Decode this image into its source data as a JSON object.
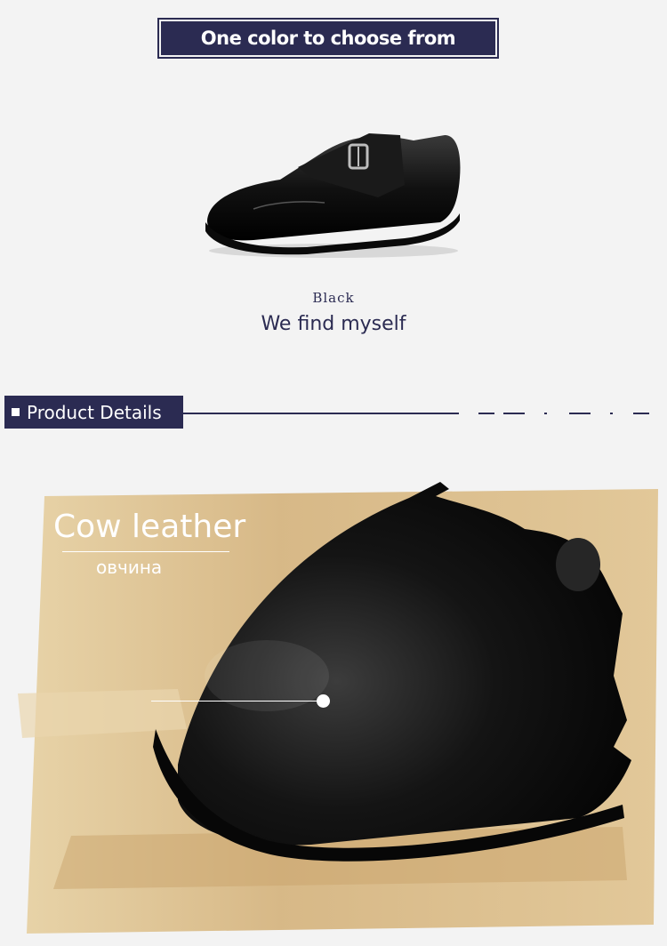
{
  "banner": {
    "text": "One color to choose from"
  },
  "colors": [
    {
      "name": "Black"
    }
  ],
  "slogan": "We find myself",
  "section": {
    "title": "Product Details"
  },
  "detail": {
    "material": "Cow leather",
    "material_translation": "овчина"
  },
  "palette": {
    "navy": "#2b2b52",
    "background": "#f3f3f3",
    "leather": "#111111",
    "wood": "#d9b987"
  }
}
